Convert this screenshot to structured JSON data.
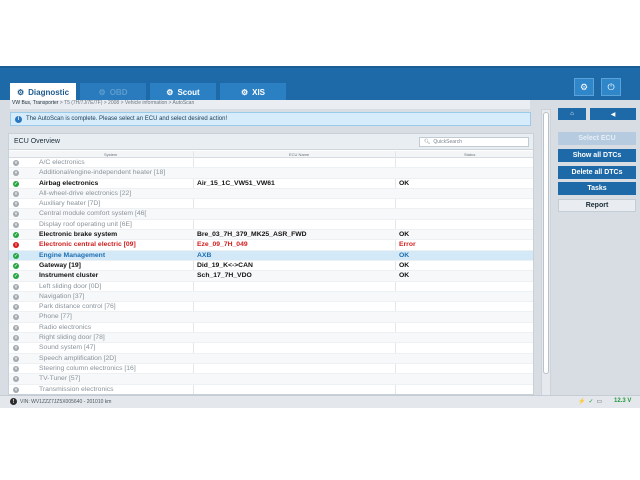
{
  "tabs": {
    "diagnostic": "Diagnostic",
    "obd": "OBD",
    "scout": "Scout",
    "xis": "XIS"
  },
  "breadcrumb": {
    "first": "VW Bus, Transporter",
    "rest": " > T5 (7H/7J/7E/7F) > 2008 > Vehicle information > AutoScan"
  },
  "info_message": "The AutoScan is complete. Please select an ECU and select desired action!",
  "panel": {
    "title": "ECU Overview",
    "search_placeholder": "QuickSearch",
    "columns": [
      "System",
      "ECU Name",
      "Status"
    ]
  },
  "rows": [
    {
      "system": "A/C electronics",
      "ecu": "",
      "status": "",
      "state": "none"
    },
    {
      "system": "Additional/engine-independent heater [18]",
      "ecu": "",
      "status": "",
      "state": "none"
    },
    {
      "system": "Airbag electronics",
      "ecu": "Air_15_1C_VW51_VW61",
      "status": "OK",
      "state": "ok"
    },
    {
      "system": "All-wheel-drive electronics [22]",
      "ecu": "",
      "status": "",
      "state": "none"
    },
    {
      "system": "Auxiliary heater [7D]",
      "ecu": "",
      "status": "",
      "state": "none"
    },
    {
      "system": "Central module comfort system [46[",
      "ecu": "",
      "status": "",
      "state": "none"
    },
    {
      "system": "Display roof operating unit [6E]",
      "ecu": "",
      "status": "",
      "state": "none"
    },
    {
      "system": "Electronic brake system",
      "ecu": "Bre_03_7H_379_MK25_ASR_FWD",
      "status": "OK",
      "state": "ok"
    },
    {
      "system": "Electronic central electric [09]",
      "ecu": "Eze_09_7H_049",
      "status": "Error",
      "state": "err"
    },
    {
      "system": "Engine Management",
      "ecu": "AXB",
      "status": "OK",
      "state": "sel"
    },
    {
      "system": "Gateway [19]",
      "ecu": "Did_19_K<->CAN",
      "status": "OK",
      "state": "ok"
    },
    {
      "system": "Instrument cluster",
      "ecu": "Sch_17_7H_VDO",
      "status": "OK",
      "state": "ok"
    },
    {
      "system": "Left sliding door [0D]",
      "ecu": "",
      "status": "",
      "state": "none"
    },
    {
      "system": "Navigation [37]",
      "ecu": "",
      "status": "",
      "state": "none"
    },
    {
      "system": "Park distance control [76]",
      "ecu": "",
      "status": "",
      "state": "none"
    },
    {
      "system": "Phone [77]",
      "ecu": "",
      "status": "",
      "state": "none"
    },
    {
      "system": "Radio electronics",
      "ecu": "",
      "status": "",
      "state": "none"
    },
    {
      "system": "Right sliding door [78]",
      "ecu": "",
      "status": "",
      "state": "none"
    },
    {
      "system": "Sound system [47]",
      "ecu": "",
      "status": "",
      "state": "none"
    },
    {
      "system": "Speech amplification [2D]",
      "ecu": "",
      "status": "",
      "state": "none"
    },
    {
      "system": "Steering column electronics [16]",
      "ecu": "",
      "status": "",
      "state": "none"
    },
    {
      "system": "TV-Tuner [57]",
      "ecu": "",
      "status": "",
      "state": "none"
    },
    {
      "system": "Transmission electronics",
      "ecu": "",
      "status": "",
      "state": "none"
    }
  ],
  "actions": {
    "select_ecu": "Select ECU",
    "show_all": "Show all DTCs",
    "delete_all": "Delete all DTCs",
    "tasks": "Tasks",
    "report": "Report"
  },
  "statusbar": {
    "vin": "VIN: WV1ZZZ7JZ5X005640 - 201010 km",
    "voltage": "12.3 V"
  },
  "icons": {
    "settings": "gear-icon",
    "power": "power-icon",
    "home": "home-icon",
    "back": "back-arrow-icon"
  }
}
